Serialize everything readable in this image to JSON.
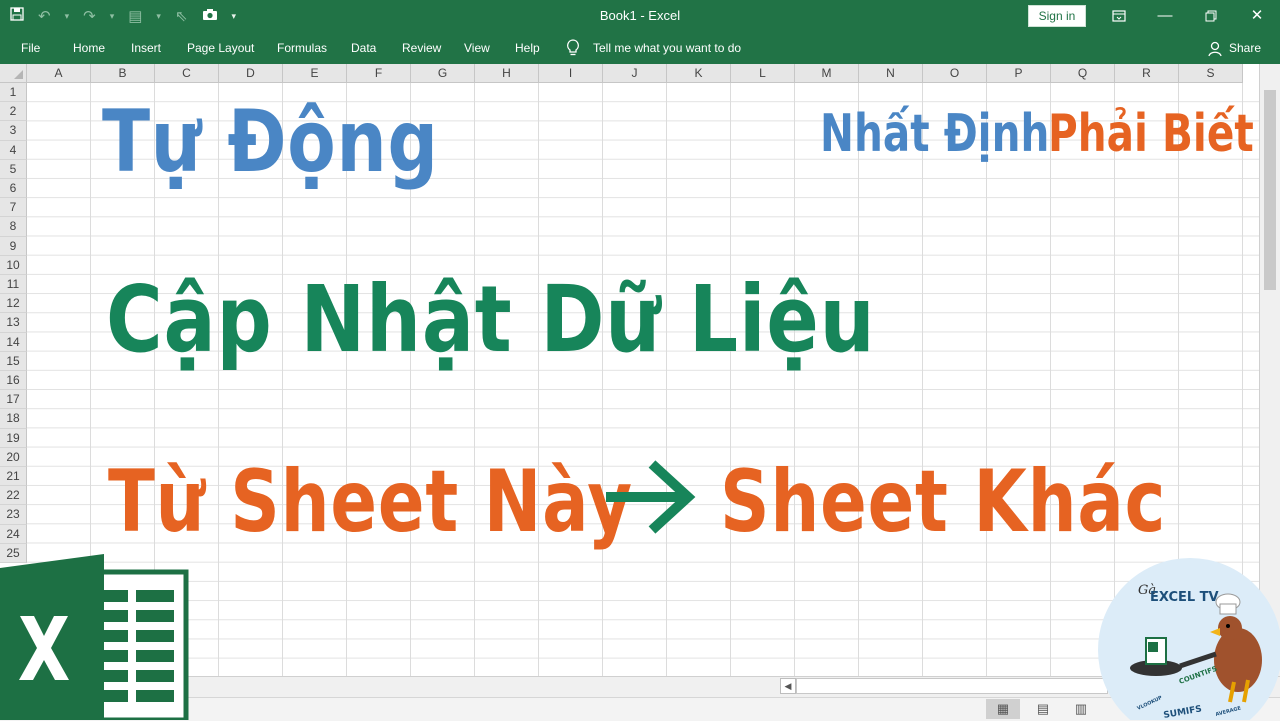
{
  "window": {
    "title": "Book1  -  Excel",
    "signin_label": "Sign in"
  },
  "menu": {
    "items": [
      "File",
      "Home",
      "Insert",
      "Page Layout",
      "Formulas",
      "Data",
      "Review",
      "View",
      "Help"
    ],
    "tell_me": "Tell me what you want to do",
    "share": "Share"
  },
  "grid": {
    "columns": [
      "A",
      "B",
      "C",
      "D",
      "E",
      "F",
      "G",
      "H",
      "I",
      "J",
      "K",
      "L",
      "M",
      "N",
      "O",
      "P",
      "Q",
      "R",
      "S"
    ],
    "rows": [
      "1",
      "2",
      "3",
      "4",
      "5",
      "6",
      "7",
      "8",
      "9",
      "10",
      "11",
      "12",
      "13",
      "14",
      "15",
      "16",
      "17",
      "18",
      "19",
      "20",
      "21",
      "22",
      "23",
      "24",
      "25"
    ]
  },
  "overlay": {
    "line1": "Tự Động",
    "line2": "Cập Nhật Dữ Liệu",
    "line3a": "Từ Sheet Này",
    "line3b": "Sheet Khác",
    "tag_part1": "Nhất Định",
    "tag_part2": "Phải Biết",
    "badge_small": "Gà",
    "badge_title": "EXCEL TV",
    "badge_words": [
      "COUNTIFS",
      "SUMIFS",
      "VLOOKUP",
      "AVERAGE"
    ]
  },
  "colors": {
    "excel_green": "#217346",
    "blue": "#4a86c5",
    "green": "#17855a",
    "orange": "#e66322"
  }
}
